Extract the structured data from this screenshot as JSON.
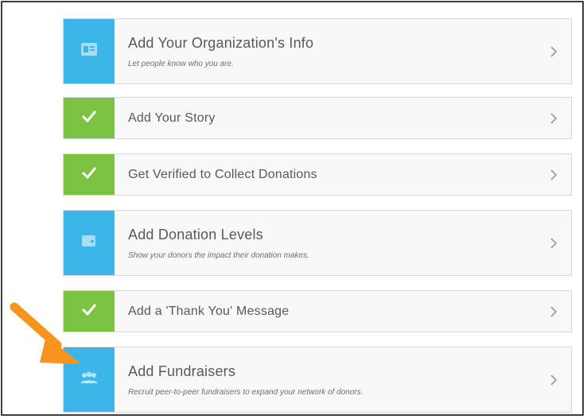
{
  "steps": [
    {
      "title": "Add Your Organization's Info",
      "subtitle": "Let people know who you are.",
      "status": "todo",
      "icon": "id-card-icon"
    },
    {
      "title": "Add Your Story",
      "subtitle": "",
      "status": "done",
      "icon": "check-icon"
    },
    {
      "title": "Get Verified to Collect Donations",
      "subtitle": "",
      "status": "done",
      "icon": "check-icon"
    },
    {
      "title": "Add Donation Levels",
      "subtitle": "Show your donors the impact their donation makes.",
      "status": "todo",
      "icon": "wallet-icon"
    },
    {
      "title": "Add a 'Thank You' Message",
      "subtitle": "",
      "status": "done",
      "icon": "check-icon"
    },
    {
      "title": "Add Fundraisers",
      "subtitle": "Recruit peer-to-peer fundraisers to expand your network of donors.",
      "status": "todo",
      "icon": "people-icon"
    }
  ],
  "colors": {
    "todo": "#3cb6e8",
    "done": "#7cc243",
    "highlight_arrow": "#f7941d"
  },
  "annotation": {
    "icon": "orange-arrow-icon"
  }
}
